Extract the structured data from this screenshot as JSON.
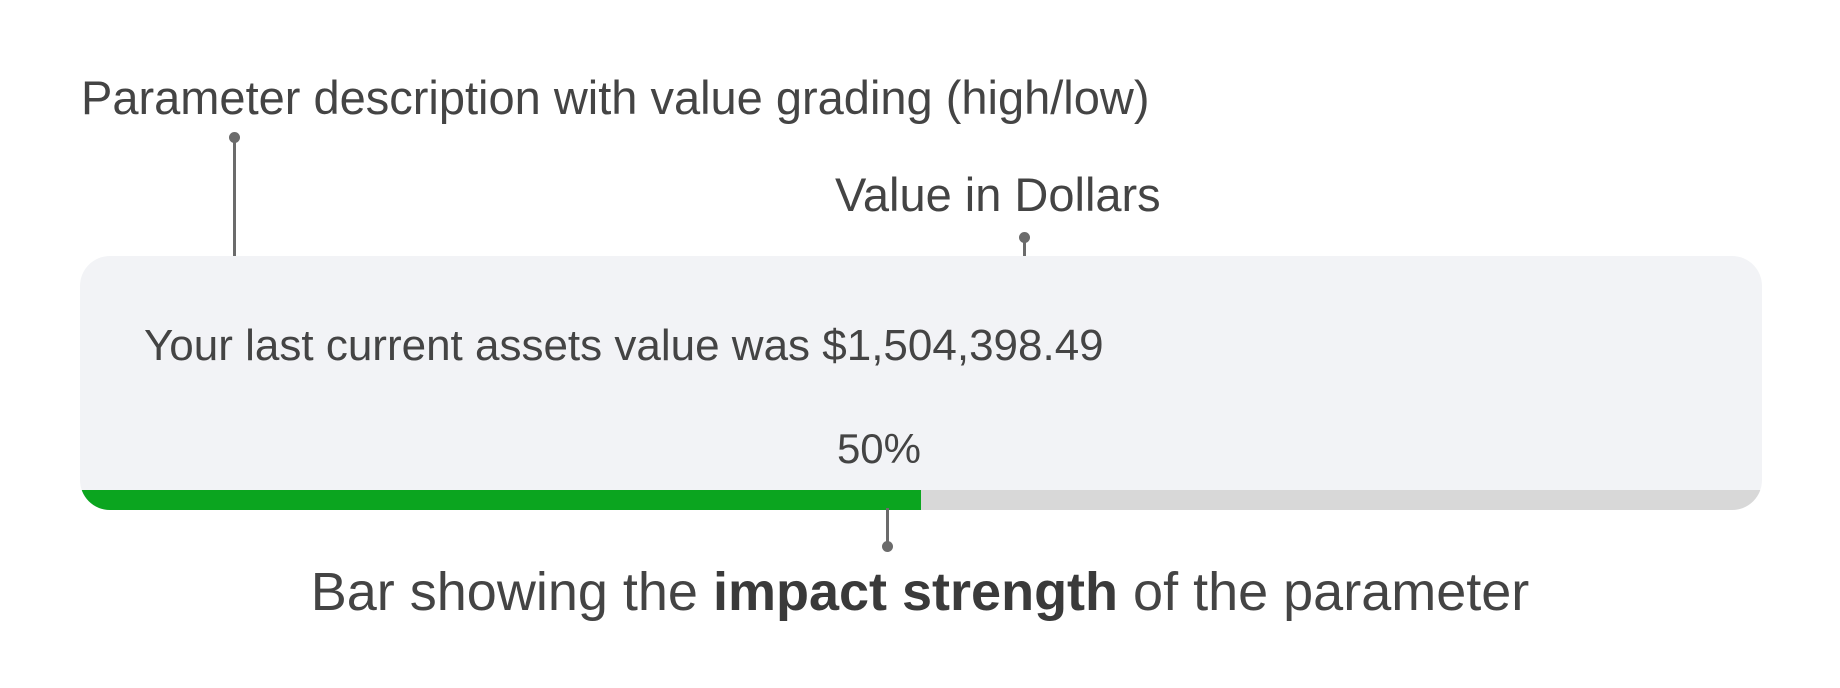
{
  "annotations": {
    "parameter_description": "Parameter description with value grading (high/low)",
    "value_in_dollars": "Value in Dollars",
    "bar_caption_prefix": "Bar showing the ",
    "bar_caption_bold": "impact strength",
    "bar_caption_suffix": " of the parameter"
  },
  "card": {
    "text_prefix": "Your last current assets value was ",
    "value": "$1,504,398.49",
    "percent_label": "50%",
    "impact_fraction": 0.5
  },
  "colors": {
    "bar_fill": "#0ba51f",
    "bar_track": "#d8d8d8",
    "card_background": "#f2f3f6",
    "leader_line": "#6b6b6b"
  }
}
